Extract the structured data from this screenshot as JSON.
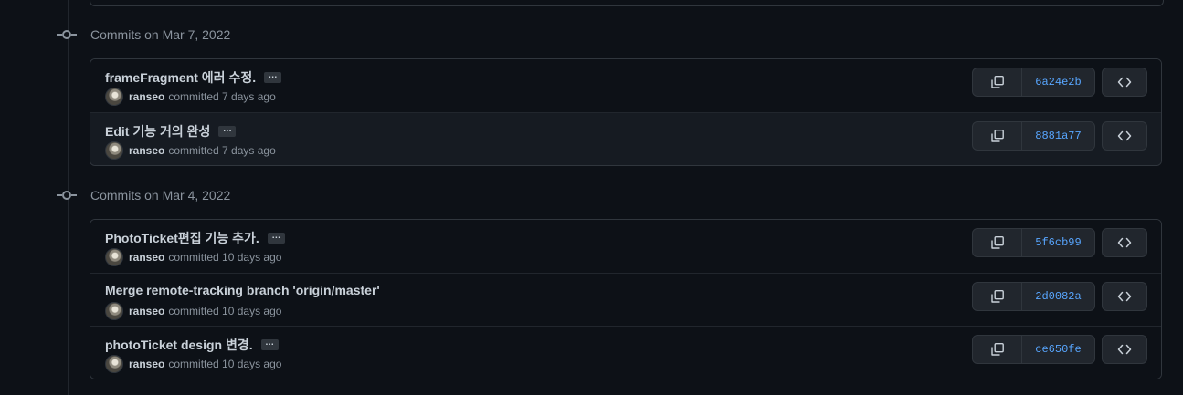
{
  "groups": [
    {
      "title": "Commits on Mar 7, 2022",
      "commits": [
        {
          "message": "frameFragment 에러 수정.",
          "has_more": true,
          "author": "ranseo",
          "meta": "committed 7 days ago",
          "sha": "6a24e2b"
        },
        {
          "message": "Edit 기능 거의 완성",
          "has_more": true,
          "author": "ranseo",
          "meta": "committed 7 days ago",
          "sha": "8881a77"
        }
      ]
    },
    {
      "title": "Commits on Mar 4, 2022",
      "commits": [
        {
          "message": "PhotoTicket편집 기능 추가.",
          "has_more": true,
          "author": "ranseo",
          "meta": "committed 10 days ago",
          "sha": "5f6cb99"
        },
        {
          "message": "Merge remote-tracking branch 'origin/master'",
          "has_more": false,
          "author": "ranseo",
          "meta": "committed 10 days ago",
          "sha": "2d0082a"
        },
        {
          "message": "photoTicket design 변경.",
          "has_more": true,
          "author": "ranseo",
          "meta": "committed 10 days ago",
          "sha": "ce650fe"
        }
      ]
    }
  ],
  "ellipsis_label": "…",
  "icons": {
    "commit": "git-commit-icon",
    "copy": "copy-icon",
    "browse": "code-icon",
    "avatar": "avatar"
  },
  "colors": {
    "background": "#0d1117",
    "border": "#30363d",
    "sha_link": "#58a6ff",
    "muted_text": "#8b949e"
  }
}
